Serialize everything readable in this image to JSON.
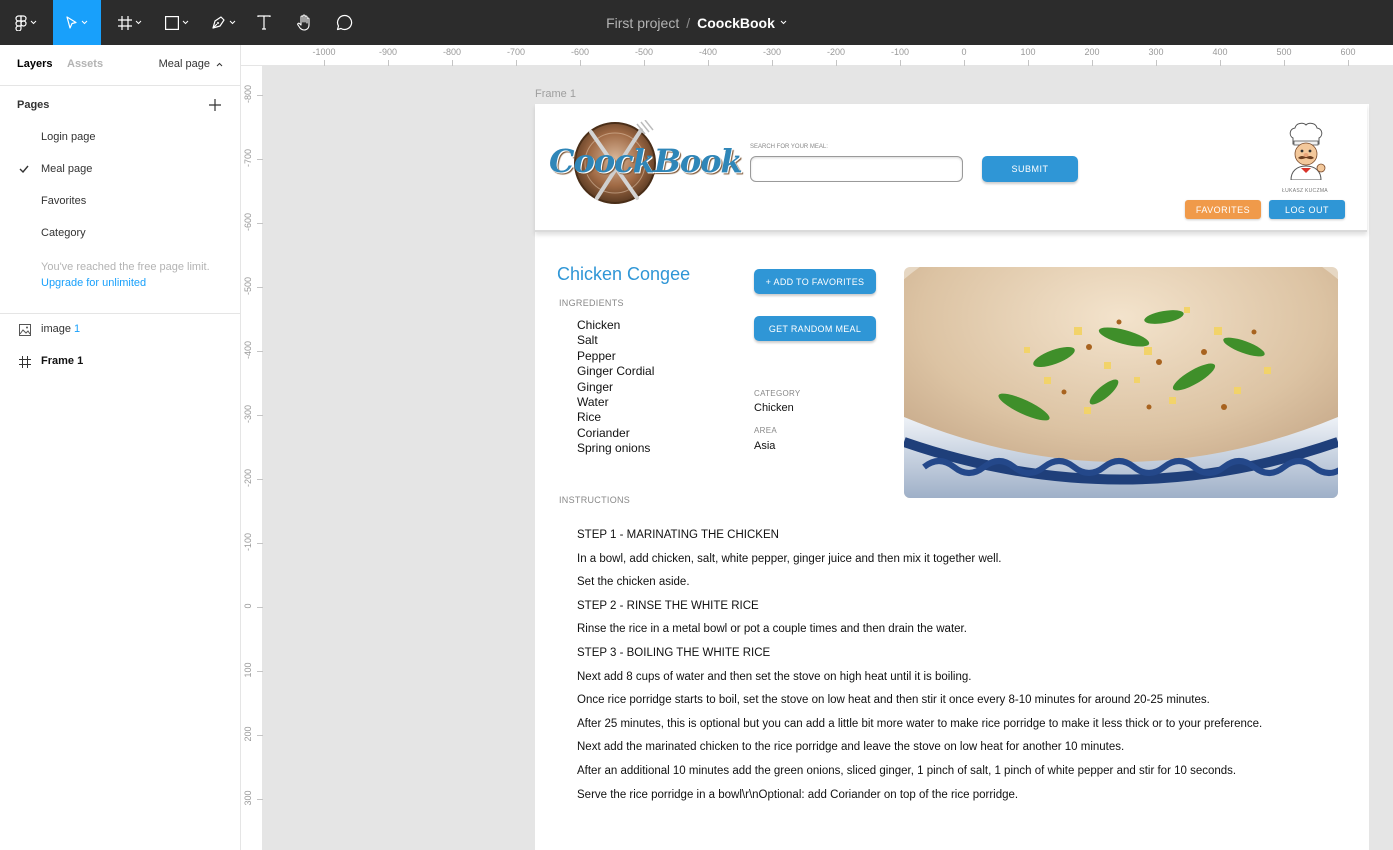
{
  "app": {
    "project": "First project",
    "separator": "/",
    "file": "CoockBook"
  },
  "left_panel": {
    "tab_layers": "Layers",
    "tab_assets": "Assets",
    "current_page": "Meal page",
    "pages_heading": "Pages",
    "pages": [
      "Login page",
      "Meal page",
      "Favorites",
      "Category"
    ],
    "selected_page": "Meal page",
    "limit_text": "You've reached the free page limit.",
    "upgrade_text": "Upgrade for unlimited",
    "layers": [
      {
        "name": "image",
        "num": "1",
        "icon": "image-icon"
      },
      {
        "name": "Frame",
        "num": "1",
        "icon": "frame-icon"
      }
    ]
  },
  "rulers": {
    "top": [
      "-1000",
      "-900",
      "-800",
      "-700",
      "-600",
      "-500",
      "-400",
      "-300",
      "-200",
      "-100",
      "0",
      "100",
      "200",
      "300",
      "400",
      "500",
      "600"
    ],
    "left": [
      "-800",
      "-700",
      "-600",
      "-500",
      "-400",
      "-300",
      "-200",
      "-100",
      "0",
      "100",
      "200",
      "300"
    ]
  },
  "frame_label": "Frame 1",
  "cookbook": {
    "logo_text": "CoockBook",
    "search_label": "SEARCH FOR YOUR MEAL:",
    "search_value": "",
    "submit_label": "SUBMIT",
    "user_name": "ŁUKASZ KUCZMA",
    "favorites_label": "FAVORITES",
    "logout_label": "LOG OUT",
    "meal_title": "Chicken Congee",
    "ingredients_label": "INGREDIENTS",
    "ingredients": [
      "Chicken",
      "Salt",
      "Pepper",
      "Ginger Cordial",
      "Ginger",
      "Water",
      "Rice",
      "Coriander",
      "Spring onions"
    ],
    "add_favorites_label": "+ ADD TO FAVORITES",
    "random_meal_label": "GET RANDOM MEAL",
    "category_label": "CATEGORY",
    "category_value": "Chicken",
    "area_label": "AREA",
    "area_value": "Asia",
    "instructions_label": "INSTRUCTIONS",
    "instructions": [
      "STEP 1 - MARINATING THE CHICKEN",
      "In a bowl, add chicken, salt, white pepper, ginger juice and then mix it together well.",
      "Set the chicken aside.",
      "STEP 2 - RINSE THE WHITE RICE",
      "Rinse the rice in a metal bowl or pot a couple times and then drain the water.",
      "STEP 3 - BOILING THE WHITE RICE",
      "Next add 8 cups of water and then set the stove on high heat until it is boiling.",
      "Once rice porridge starts to boil, set the stove on low heat and then stir it once every 8-10 minutes for around 20-25 minutes.",
      "After 25 minutes, this is optional but you can add a little bit more water to make rice porridge to make it less thick or to your preference.",
      "Next add the marinated chicken to the rice porridge and leave the stove on low heat for another 10 minutes.",
      "After an additional 10 minutes add the green onions, sliced ginger, 1 pinch of salt, 1 pinch of white pepper and stir for 10 seconds.",
      "Serve the rice porridge in a bowl\\r\\nOptional: add Coriander on top of the rice porridge."
    ]
  },
  "colors": {
    "toolbar_bg": "#2c2c2c",
    "accent": "#18a0fb",
    "brand_blue": "#2f96d6",
    "brand_orange": "#f09a4a"
  }
}
